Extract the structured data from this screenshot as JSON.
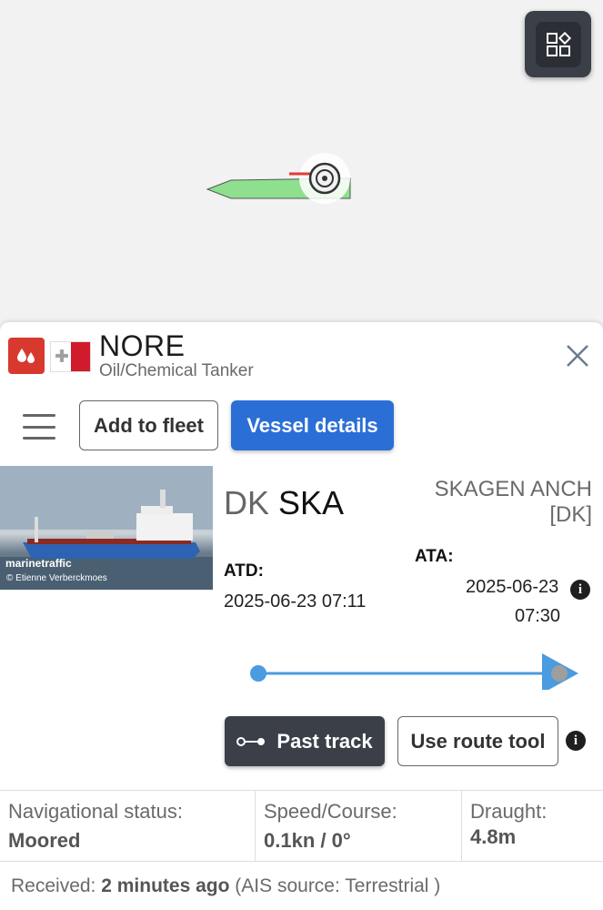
{
  "map": {
    "layers_icon": "layers-icon",
    "vessel_marker_color": "#8ee08e",
    "heading_line_color": "#e53935"
  },
  "vessel": {
    "name": "NORE",
    "type": "Oil/Chemical Tanker",
    "type_icon": "tanker-icon",
    "type_icon_color": "#d8392f",
    "flag": "malta-flag"
  },
  "toolbar": {
    "menu_icon": "hamburger-icon",
    "add_to_fleet": "Add to fleet",
    "vessel_details": "Vessel details"
  },
  "photo": {
    "watermark": "marinetraffic",
    "credit": "© Etienne Verberckmoes"
  },
  "voyage": {
    "from_country": "DK",
    "from_code": "SKA",
    "to_port": "SKAGEN ANCH",
    "to_country": "[DK]",
    "atd_label": "ATD:",
    "atd_value": "2025-06-23 07:11",
    "ata_label": "ATA:",
    "ata_date": "2025-06-23",
    "ata_time": "07:30",
    "progress_fraction": 1.0,
    "progress_color": "#4a9be0"
  },
  "actions": {
    "past_track": "Past track",
    "use_route_tool": "Use route tool"
  },
  "stats": {
    "nav_status_label": "Navigational status:",
    "nav_status_value": "Moored",
    "speed_course_label": "Speed/Course:",
    "speed_course_value": "0.1kn / 0°",
    "draught_label": "Draught:",
    "draught_value": "4.8m"
  },
  "received": {
    "prefix": "Received:",
    "time": "2 minutes ago",
    "source": "(AIS source: Terrestrial )"
  }
}
